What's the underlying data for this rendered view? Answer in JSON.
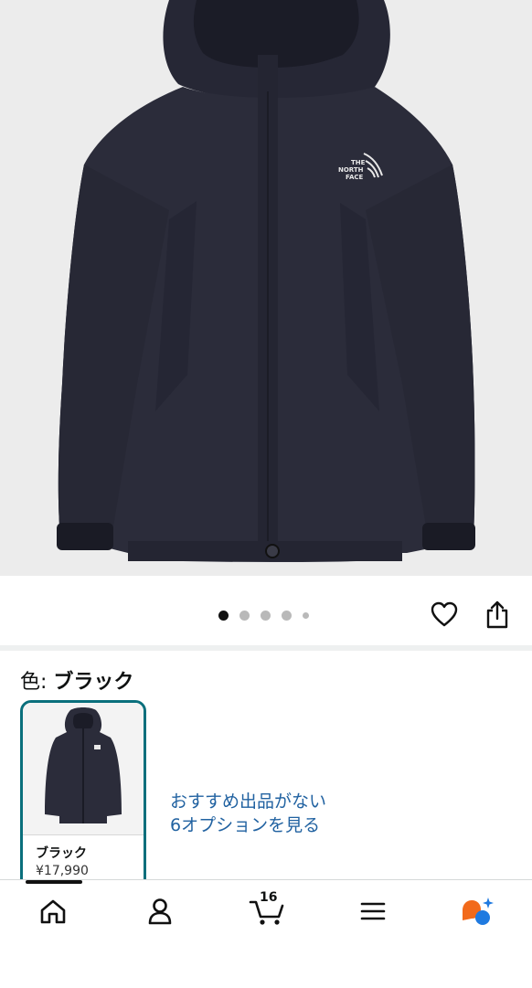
{
  "product": {
    "image_alt": "THE NORTH FACE kids jacket",
    "logo_text": [
      "THE",
      "NORTH",
      "FACE"
    ],
    "carousel": {
      "total": 5,
      "active": 1
    }
  },
  "color_selector": {
    "label": "色:",
    "selected": "ブラック"
  },
  "variants": [
    {
      "name": "ブラック",
      "price": "¥17,990",
      "selected": true
    }
  ],
  "offer_link": {
    "line1": "おすすめ出品がない",
    "line2": "6オプションを見る"
  },
  "bottom_nav": {
    "cart_count": "16",
    "items": [
      "home",
      "account",
      "cart",
      "menu",
      "rufus"
    ]
  },
  "colors": {
    "accent": "#0a6f7c",
    "link": "#2162a1",
    "jacket": "#2b2c3a"
  }
}
